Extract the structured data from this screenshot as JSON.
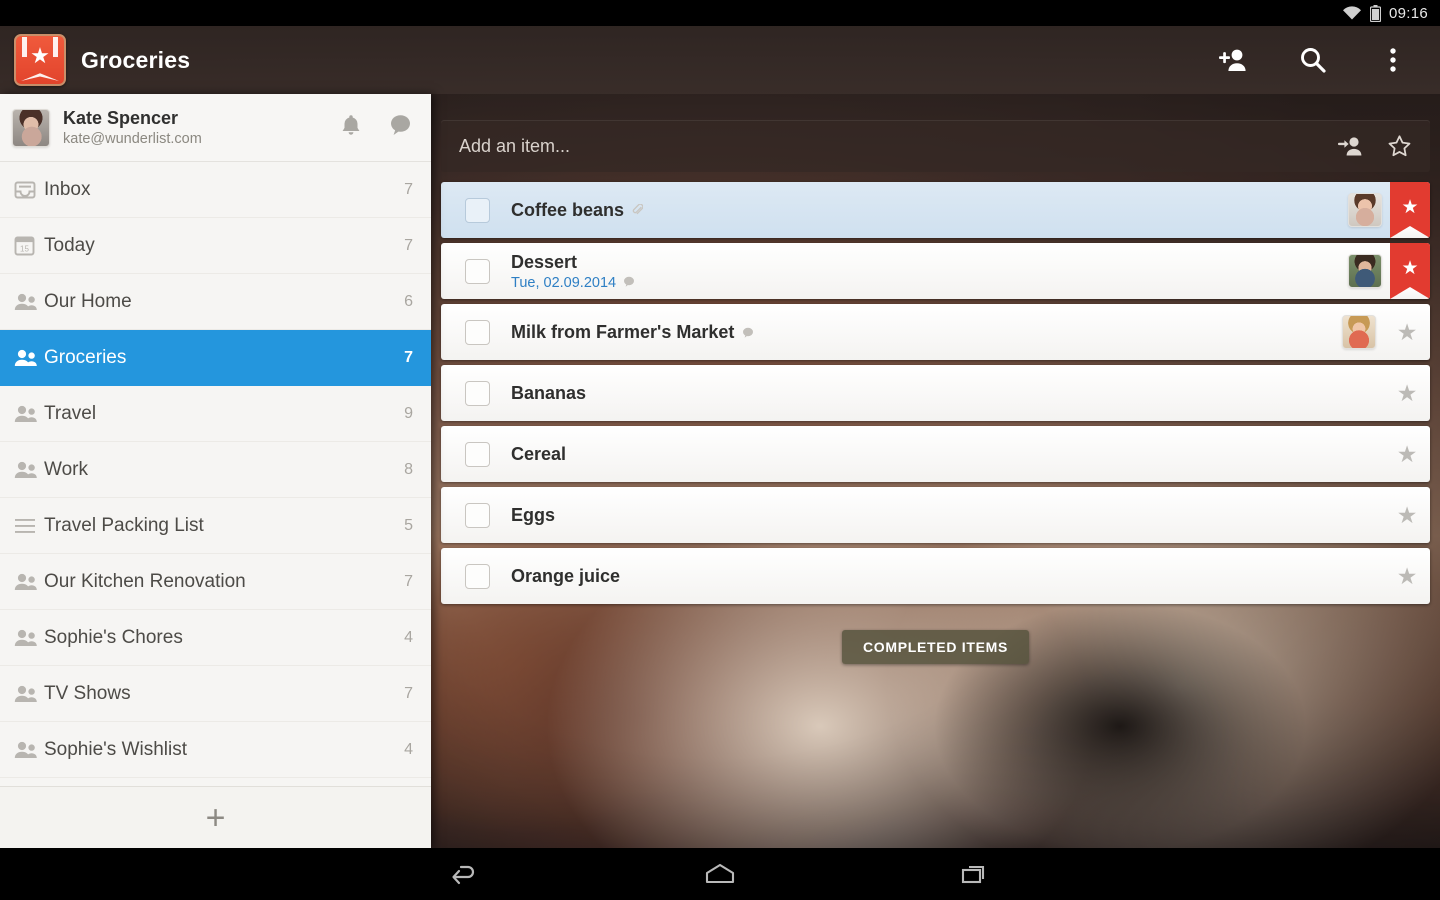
{
  "status_bar": {
    "time": "09:16",
    "wifi_icon": "wifi-icon",
    "battery_icon": "battery-icon"
  },
  "action_bar": {
    "logo_icon": "wunderlist-logo-icon",
    "title": "Groceries",
    "actions": [
      {
        "icon": "add-person-icon",
        "name": "add-person-button"
      },
      {
        "icon": "search-icon",
        "name": "search-button"
      },
      {
        "icon": "overflow-menu-icon",
        "name": "overflow-menu-button"
      }
    ]
  },
  "sidebar": {
    "account": {
      "name": "Kate Spencer",
      "email": "kate@wunderlist.com",
      "avatar_icon": "user-avatar",
      "notifications_icon": "bell-icon",
      "chat_icon": "chat-bubble-icon"
    },
    "items": [
      {
        "label": "Inbox",
        "count": "7",
        "icon": "inbox-icon",
        "selected": false
      },
      {
        "label": "Today",
        "count": "7",
        "icon": "calendar-icon",
        "selected": false
      },
      {
        "label": "Our Home",
        "count": "6",
        "icon": "people-icon",
        "selected": false
      },
      {
        "label": "Groceries",
        "count": "7",
        "icon": "people-icon",
        "selected": true
      },
      {
        "label": "Travel",
        "count": "9",
        "icon": "people-icon",
        "selected": false
      },
      {
        "label": "Work",
        "count": "8",
        "icon": "people-icon",
        "selected": false
      },
      {
        "label": "Travel Packing List",
        "count": "5",
        "icon": "list-icon",
        "selected": false
      },
      {
        "label": "Our Kitchen Renovation",
        "count": "7",
        "icon": "people-icon",
        "selected": false
      },
      {
        "label": "Sophie's Chores",
        "count": "4",
        "icon": "people-icon",
        "selected": false
      },
      {
        "label": "TV Shows",
        "count": "7",
        "icon": "people-icon",
        "selected": false
      },
      {
        "label": "Sophie's Wishlist",
        "count": "4",
        "icon": "people-icon",
        "selected": false
      }
    ],
    "add_list": {
      "label": "+",
      "icon": "plus-icon"
    }
  },
  "content": {
    "add_item": {
      "placeholder": "Add an item...",
      "assign_icon": "assign-person-icon",
      "star_icon": "star-outline-icon"
    },
    "tasks": [
      {
        "title": "Coffee beans",
        "subtitle": "",
        "starred": true,
        "avatar": "av1",
        "selected": true,
        "note_icon": "paperclip-icon",
        "comment_icon": ""
      },
      {
        "title": "Dessert",
        "subtitle": "Tue, 02.09.2014",
        "starred": true,
        "avatar": "av2",
        "selected": false,
        "note_icon": "",
        "comment_icon": "comment-icon"
      },
      {
        "title": "Milk from Farmer's Market",
        "subtitle": "",
        "starred": false,
        "avatar": "av3",
        "selected": false,
        "note_icon": "",
        "comment_icon": "comment-icon"
      },
      {
        "title": "Bananas",
        "subtitle": "",
        "starred": false,
        "avatar": "",
        "selected": false,
        "note_icon": "",
        "comment_icon": ""
      },
      {
        "title": "Cereal",
        "subtitle": "",
        "starred": false,
        "avatar": "",
        "selected": false,
        "note_icon": "",
        "comment_icon": ""
      },
      {
        "title": "Eggs",
        "subtitle": "",
        "starred": false,
        "avatar": "",
        "selected": false,
        "note_icon": "",
        "comment_icon": ""
      },
      {
        "title": "Orange juice",
        "subtitle": "",
        "starred": false,
        "avatar": "",
        "selected": false,
        "note_icon": "",
        "comment_icon": ""
      }
    ],
    "completed_button": {
      "label": "COMPLETED ITEMS"
    }
  },
  "nav_bar": {
    "buttons": [
      {
        "icon": "back-icon",
        "name": "back-button"
      },
      {
        "icon": "home-icon",
        "name": "home-button"
      },
      {
        "icon": "recents-icon",
        "name": "recents-button"
      }
    ]
  },
  "colors": {
    "accent_blue": "#2496dd",
    "star_red": "#e23b30",
    "date_blue": "#2e7fc4",
    "sidebar_bg": "#f6f5f3"
  }
}
